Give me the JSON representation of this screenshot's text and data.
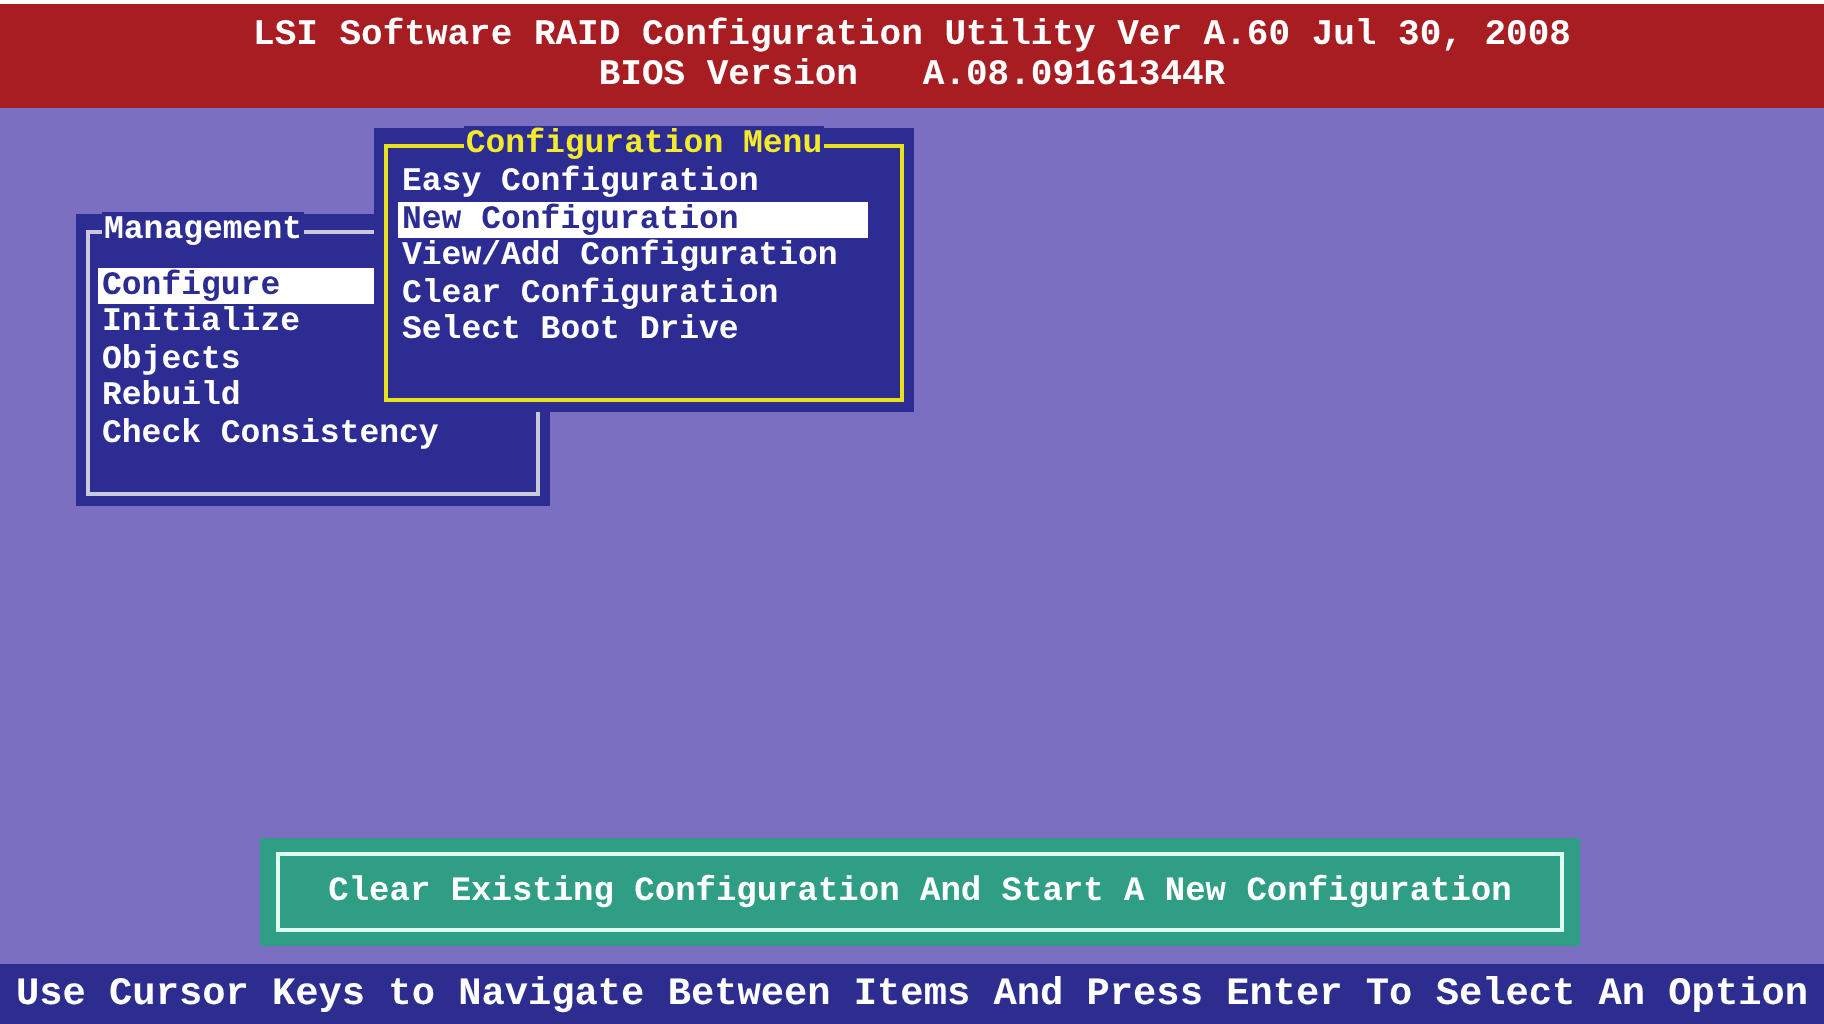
{
  "header": {
    "title": "LSI Software RAID Configuration Utility Ver A.60 Jul 30, 2008",
    "subtitle": "BIOS Version   A.08.09161344R"
  },
  "menus": [
    {
      "kind": "main",
      "title": "Management",
      "items": [
        {
          "label": "Configure",
          "selected": true
        },
        {
          "label": "Initialize",
          "selected": false
        },
        {
          "label": "Objects",
          "selected": false
        },
        {
          "label": "Rebuild",
          "selected": false
        },
        {
          "label": "Check Consistency",
          "selected": false
        }
      ]
    },
    {
      "kind": "submenu",
      "title": "Configuration Menu",
      "items": [
        {
          "label": "Easy Configuration",
          "selected": false
        },
        {
          "label": "New Configuration",
          "selected": true
        },
        {
          "label": "View/Add Configuration",
          "selected": false
        },
        {
          "label": "Clear Configuration",
          "selected": false
        },
        {
          "label": "Select Boot Drive",
          "selected": false
        }
      ]
    }
  ],
  "help_text": "Clear Existing Configuration And Start A New Configuration",
  "status_bar": "Use Cursor Keys to Navigate Between Items And Press Enter To Select An Option"
}
